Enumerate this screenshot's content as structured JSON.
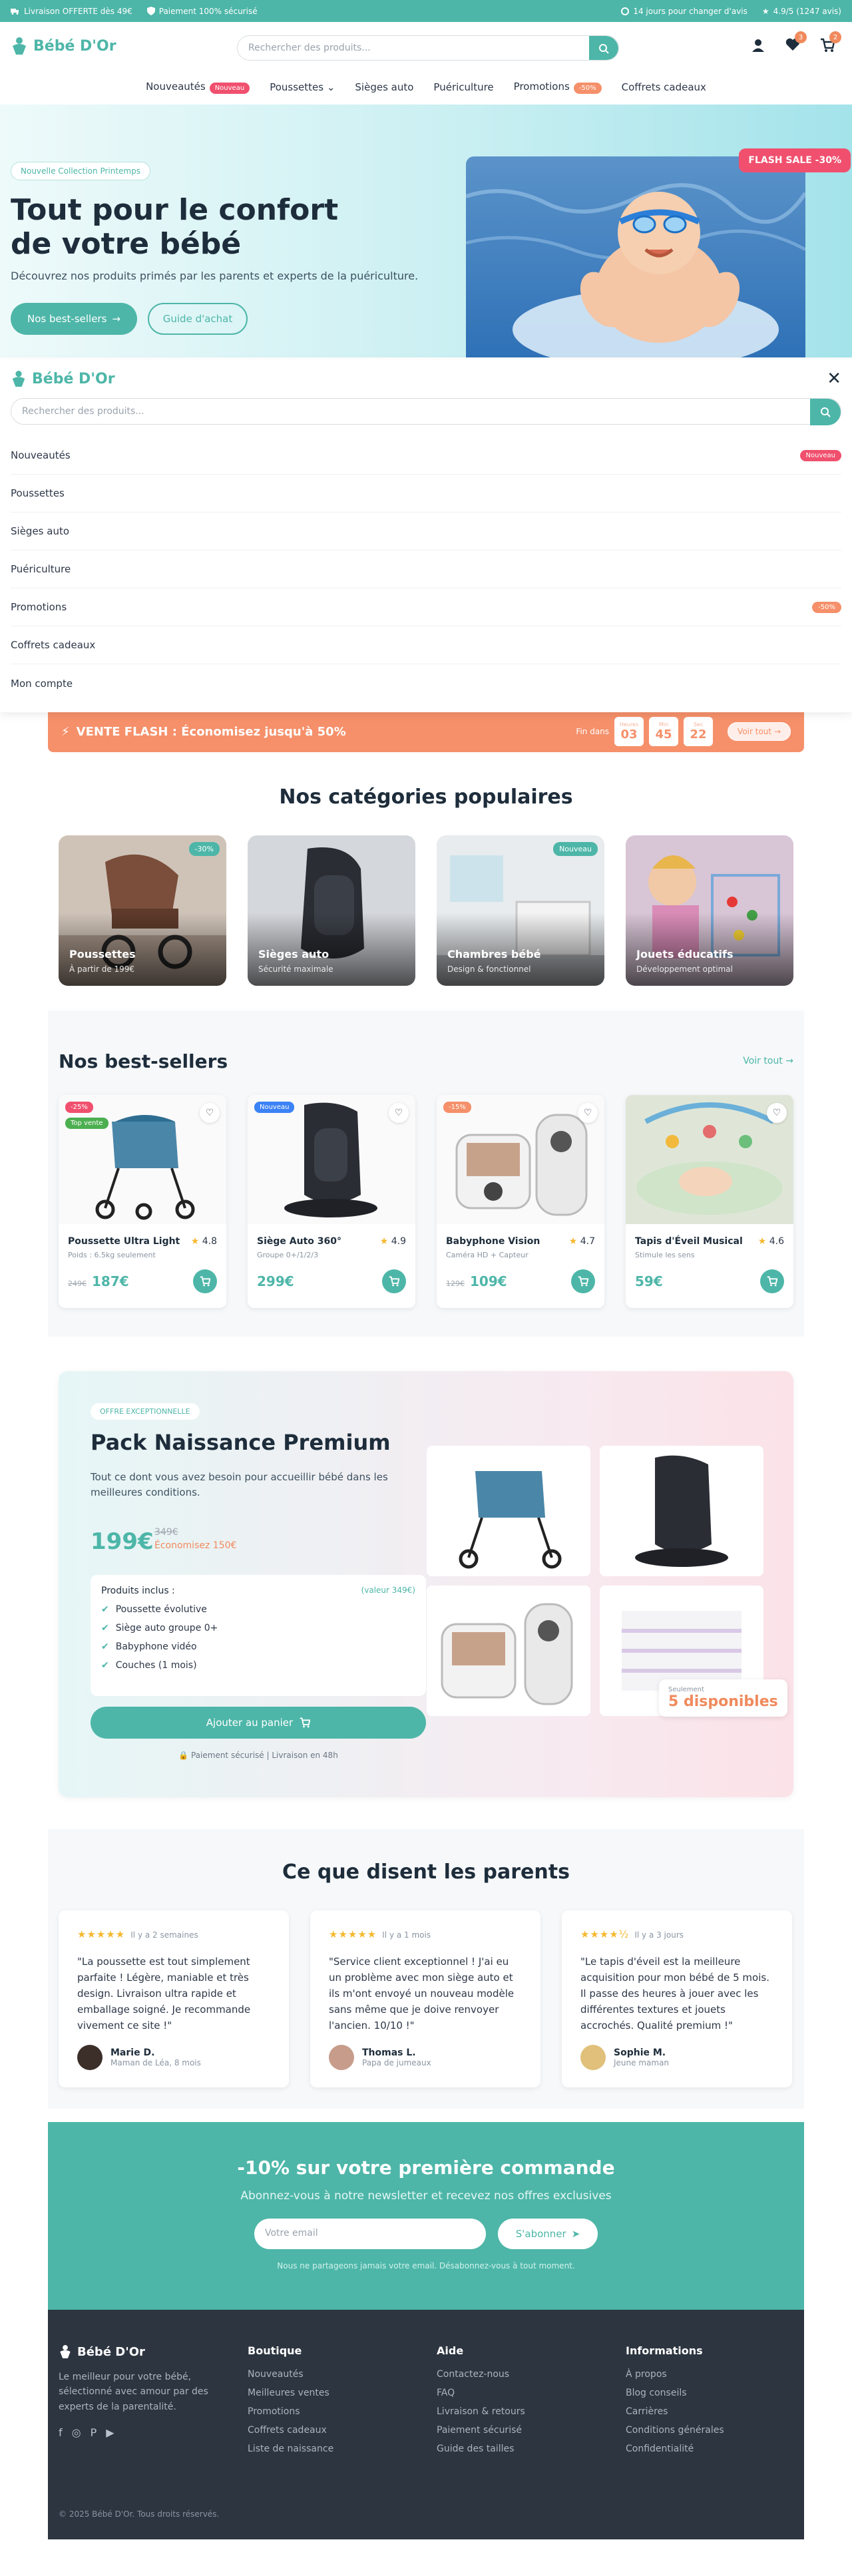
{
  "topbar": {
    "left": [
      "Livraison OFFERTE dès 49€",
      "Paiement 100% sécurisé"
    ],
    "right": [
      "14 jours pour changer d'avis",
      "4.9/5 (1247 avis)"
    ]
  },
  "brand": {
    "name": "Bébé D'Or",
    "accent": "#4db6a8",
    "orange": "#f5906a",
    "red": "#f0506e"
  },
  "header": {
    "search_placeholder": "Rechercher des produits...",
    "wishlist_count": "3",
    "cart_count": "2"
  },
  "nav": [
    {
      "label": "Nouveautés",
      "badge": "Nouveau"
    },
    {
      "label": "Poussettes",
      "badge": ""
    },
    {
      "label": "Sièges auto",
      "badge": ""
    },
    {
      "label": "Puériculture",
      "badge": ""
    },
    {
      "label": "Promotions",
      "badge": "-50%"
    },
    {
      "label": "Coffrets cadeaux",
      "badge": ""
    }
  ],
  "hero": {
    "tag": "Nouvelle Collection Printemps",
    "title": "Tout pour le confort de votre bébé",
    "subtitle": "Découvrez nos produits primés par les parents et experts de la puériculture.",
    "btn_primary": "Nos best-sellers",
    "btn_secondary": "Guide d'achat",
    "flash": "FLASH SALE -30%"
  },
  "drawer": {
    "logo": "Bébé D'Or",
    "search_placeholder": "Rechercher des produits...",
    "items": [
      {
        "label": "Nouveautés",
        "badge": "Nouveau"
      },
      {
        "label": "Poussettes",
        "badge": ""
      },
      {
        "label": "Sièges auto",
        "badge": ""
      },
      {
        "label": "Puériculture",
        "badge": ""
      },
      {
        "label": "Promotions",
        "badge": "-50%"
      },
      {
        "label": "Coffrets cadeaux",
        "badge": ""
      },
      {
        "label": "Mon compte",
        "badge": ""
      }
    ]
  },
  "flash": {
    "title": "VENTE FLASH : Économisez jusqu'à 50%",
    "ends": "Fin dans",
    "units": [
      "Heures",
      "Min",
      "Sec"
    ],
    "values": [
      "03",
      "45",
      "22"
    ],
    "cta": "Voir tout"
  },
  "categories": {
    "title": "Nos catégories populaires",
    "items": [
      {
        "name": "Poussettes",
        "sub": "À partir de 199€",
        "badge": "-30%"
      },
      {
        "name": "Sièges auto",
        "sub": "Sécurité maximale",
        "badge": ""
      },
      {
        "name": "Chambres bébé",
        "sub": "Design & fonctionnel",
        "badge": "Nouveau"
      },
      {
        "name": "Jouets éducatifs",
        "sub": "Développement optimal",
        "badge": ""
      }
    ]
  },
  "bestsellers": {
    "title": "Nos best-sellers",
    "link": "Voir tout",
    "items": [
      {
        "name": "Poussette Ultra Light",
        "sub": "Poids : 6.5kg seulement",
        "rating": "4.8",
        "price": "187€",
        "old": "249€",
        "tags": [
          "-25%",
          "Top vente"
        ]
      },
      {
        "name": "Siège Auto 360°",
        "sub": "Groupe 0+/1/2/3",
        "rating": "4.9",
        "price": "299€",
        "old": "",
        "tags": [
          "Nouveau"
        ]
      },
      {
        "name": "Babyphone Vision",
        "sub": "Caméra HD + Capteur",
        "rating": "4.7",
        "price": "109€",
        "old": "129€",
        "tags": [
          "-15%"
        ]
      },
      {
        "name": "Tapis d'Éveil Musical",
        "sub": "Stimule les sens",
        "rating": "4.6",
        "price": "59€",
        "old": "",
        "tags": []
      }
    ]
  },
  "pack": {
    "tag": "OFFRE EXCEPTIONNELLE",
    "title": "Pack Naissance Premium",
    "desc": "Tout ce dont vous avez besoin pour accueillir bébé dans les meilleures conditions.",
    "price": "199€",
    "old": "349€",
    "save": "Économisez 150€",
    "incl_title": "Produits inclus :",
    "incl_value": "(valeur 349€)",
    "items": [
      "Poussette évolutive",
      "Siège auto groupe 0+",
      "Babyphone vidéo",
      "Couches (1 mois)"
    ],
    "cta": "Ajouter au panier",
    "secure": "Paiement sécurisé | Livraison en 48h",
    "stock_label": "Seulement",
    "stock": "5 disponibles"
  },
  "reviews": {
    "title": "Ce que disent les parents",
    "items": [
      {
        "stars": "★★★★★",
        "ago": "Il y a 2 semaines",
        "text": "\"La poussette est tout simplement parfaite ! Légère, maniable et très design. Livraison ultra rapide et emballage soigné. Je recommande vivement ce site !\"",
        "name": "Marie D.",
        "role": "Maman de Léa, 8 mois"
      },
      {
        "stars": "★★★★★",
        "ago": "Il y a 1 mois",
        "text": "\"Service client exceptionnel ! J'ai eu un problème avec mon siège auto et ils m'ont envoyé un nouveau modèle sans même que je doive renvoyer l'ancien. 10/10 !\"",
        "name": "Thomas L.",
        "role": "Papa de jumeaux"
      },
      {
        "stars": "★★★★½",
        "ago": "Il y a 3 jours",
        "text": "\"Le tapis d'éveil est la meilleure acquisition pour mon bébé de 5 mois. Il passe des heures à jouer avec les différentes textures et jouets accrochés. Qualité premium !\"",
        "name": "Sophie M.",
        "role": "Jeune maman"
      }
    ]
  },
  "newsletter": {
    "title": "-10% sur votre première commande",
    "sub": "Abonnez-vous à notre newsletter et recevez nos offres exclusives",
    "placeholder": "Votre email",
    "cta": "S'abonner",
    "note": "Nous ne partageons jamais votre email. Désabonnez-vous à tout moment."
  },
  "footer": {
    "brand": "Bébé D'Or",
    "desc": "Le meilleur pour votre bébé, sélectionné avec amour par des experts de la parentalité.",
    "cols": [
      {
        "title": "Boutique",
        "links": [
          "Nouveautés",
          "Meilleures ventes",
          "Promotions",
          "Coffrets cadeaux",
          "Liste de naissance"
        ]
      },
      {
        "title": "Aide",
        "links": [
          "Contactez-nous",
          "FAQ",
          "Livraison & retours",
          "Paiement sécurisé",
          "Guide des tailles"
        ]
      },
      {
        "title": "Informations",
        "links": [
          "À propos",
          "Blog conseils",
          "Carrières",
          "Conditions générales",
          "Confidentialité"
        ]
      }
    ],
    "copy": "© 2025 Bébé D'Or. Tous droits réservés."
  }
}
